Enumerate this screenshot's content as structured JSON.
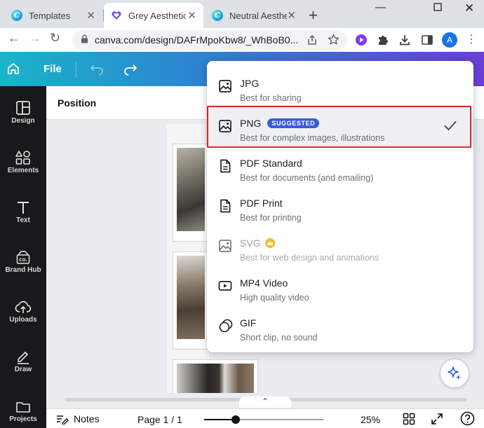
{
  "browser": {
    "tabs": [
      {
        "title": "Templates",
        "favicon": "canva-logo",
        "active": false
      },
      {
        "title": "Grey Aesthetic",
        "favicon": "heart-logo",
        "active": true
      },
      {
        "title": "Neutral Aesthe",
        "favicon": "canva-logo",
        "active": false
      }
    ],
    "address": "canva.com/design/DAFrMpoKbw8/_WhBoB0...",
    "profile_initial": "A",
    "window_controls": [
      "minimize",
      "maximize",
      "close"
    ]
  },
  "canva": {
    "file_label": "File",
    "favicon_letter": "C",
    "context_label": "Position",
    "sidebar": [
      {
        "label": "Design",
        "icon": "layout-icon"
      },
      {
        "label": "Elements",
        "icon": "shapes-icon"
      },
      {
        "label": "Text",
        "icon": "text-icon"
      },
      {
        "label": "Brand Hub",
        "icon": "brand-icon"
      },
      {
        "label": "Uploads",
        "icon": "cloud-upload-icon"
      },
      {
        "label": "Draw",
        "icon": "pen-icon"
      },
      {
        "label": "Projects",
        "icon": "folder-icon"
      }
    ],
    "brand_icon_text": "CO."
  },
  "download_menu": {
    "selected": "PNG",
    "options": [
      {
        "name": "JPG",
        "desc": "Best for sharing",
        "icon": "image-icon"
      },
      {
        "name": "PNG",
        "desc": "Best for complex images, illustrations",
        "icon": "image-icon",
        "badge": "SUGGESTED"
      },
      {
        "name": "PDF Standard",
        "desc": "Best for documents (and emailing)",
        "icon": "document-icon"
      },
      {
        "name": "PDF Print",
        "desc": "Best for printing",
        "icon": "document-icon"
      },
      {
        "name": "SVG",
        "desc": "Best for web design and animations",
        "icon": "image-icon",
        "premium": true
      },
      {
        "name": "MP4 Video",
        "desc": "High quality video",
        "icon": "video-icon"
      },
      {
        "name": "GIF",
        "desc": "Short clip, no sound",
        "icon": "gif-icon"
      }
    ]
  },
  "footer": {
    "notes_label": "Notes",
    "page_label": "Page 1 / 1",
    "zoom_label": "25%",
    "zoom_fraction": 0.25
  },
  "colors": {
    "accent": "#3b5bdb",
    "highlight_border": "#d92626",
    "sidebar_bg": "#18191b",
    "premium_gold": "#f2b92c"
  }
}
